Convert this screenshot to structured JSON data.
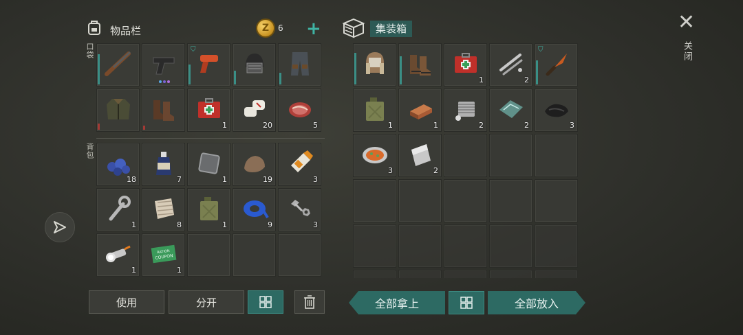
{
  "inventory": {
    "title": "物品栏",
    "coin_symbol": "Z",
    "coin_count": "6",
    "add_symbol": "+",
    "pocket_label": "口袋",
    "backpack_label": "背包",
    "pockets": [
      {
        "icon": "shotgun-icon",
        "qty": "",
        "dur": "teal",
        "dur_level": 0.75
      },
      {
        "icon": "pistol-icon",
        "qty": "",
        "dur": "",
        "dots": [
          "#5aa8e6",
          "#7a64d8",
          "#b070e0"
        ]
      },
      {
        "icon": "flare-gun-icon",
        "qty": "",
        "dur": "teal",
        "dur_level": 0.5,
        "lock": true
      },
      {
        "icon": "helmet-icon",
        "qty": "",
        "dur": "teal",
        "dur_level": 0.35
      },
      {
        "icon": "pants-icon",
        "qty": "",
        "dur": "teal",
        "dur_level": 0.3
      },
      {
        "icon": "jacket-icon",
        "qty": "",
        "dur": "red",
        "dur_level": 0.15
      },
      {
        "icon": "boots-icon",
        "qty": "",
        "dur": "red",
        "dur_level": 0.1
      },
      {
        "icon": "medkit-icon",
        "qty": "1"
      },
      {
        "icon": "bandage-icon",
        "qty": "20"
      },
      {
        "icon": "meat-icon",
        "qty": "5"
      }
    ],
    "backpack": [
      {
        "icon": "blueberries-icon",
        "qty": "18"
      },
      {
        "icon": "bottle-icon",
        "qty": "7"
      },
      {
        "icon": "metal-plate-icon",
        "qty": "1"
      },
      {
        "icon": "stone-icon",
        "qty": "19"
      },
      {
        "icon": "glue-icon",
        "qty": "3"
      },
      {
        "icon": "wrench-icon",
        "qty": "1"
      },
      {
        "icon": "cloth-icon",
        "qty": "8"
      },
      {
        "icon": "jerrycan-icon",
        "qty": "1"
      },
      {
        "icon": "tape-icon",
        "qty": "9"
      },
      {
        "icon": "nuts-bolts-icon",
        "qty": "3"
      },
      {
        "icon": "flashlight-icon",
        "qty": "1"
      },
      {
        "icon": "coupon-icon",
        "qty": "1",
        "text": "RATION COUPON"
      },
      {
        "icon": "",
        "qty": ""
      },
      {
        "icon": "",
        "qty": ""
      },
      {
        "icon": "",
        "qty": ""
      }
    ],
    "buttons": {
      "use": "使用",
      "split": "分开",
      "sort_icon": "grid-icon",
      "trash_icon": "trash-icon"
    }
  },
  "container": {
    "title": "集装箱",
    "items": [
      {
        "icon": "ushanka-icon",
        "qty": "",
        "dur": "teal",
        "dur_level": 0.8
      },
      {
        "icon": "work-boots-icon",
        "qty": "",
        "dur": "teal",
        "dur_level": 0.7
      },
      {
        "icon": "medkit-icon",
        "qty": "1"
      },
      {
        "icon": "pipe-icon",
        "qty": "2"
      },
      {
        "icon": "knife-icon",
        "qty": "",
        "dur": "teal",
        "dur_level": 0.6,
        "lock": true
      },
      {
        "icon": "jerrycan-icon",
        "qty": "1"
      },
      {
        "icon": "copper-bar-icon",
        "qty": "1"
      },
      {
        "icon": "engine-part-icon",
        "qty": "2"
      },
      {
        "icon": "glass-icon",
        "qty": "2"
      },
      {
        "icon": "rubber-icon",
        "qty": "3"
      },
      {
        "icon": "food-plate-icon",
        "qty": "3"
      },
      {
        "icon": "metal-sheet-icon",
        "qty": "2"
      }
    ],
    "buttons": {
      "take_all": "全部拿上",
      "put_all": "全部放入",
      "sort_icon": "grid-icon"
    }
  },
  "close": {
    "label": "关闭",
    "icon": "close-icon"
  },
  "side": {
    "icon": "send-icon"
  }
}
